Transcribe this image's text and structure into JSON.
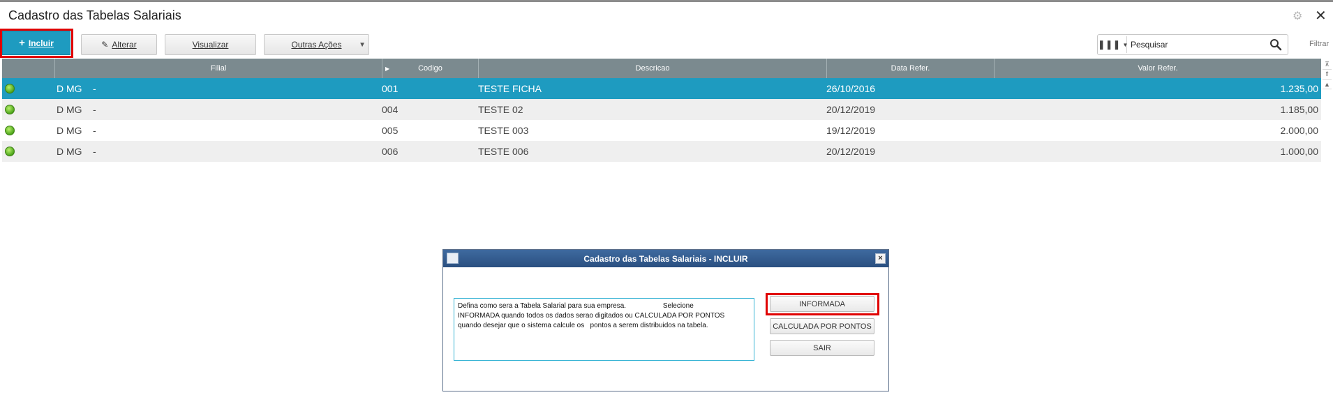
{
  "window": {
    "title": "Cadastro das Tabelas Salariais"
  },
  "toolbar": {
    "incluir": "Incluir",
    "alterar": "Alterar",
    "visualizar": "Visualizar",
    "outras_acoes": "Outras Ações"
  },
  "search": {
    "value": "Pesquisar",
    "filter_label": "Filtrar"
  },
  "table": {
    "columns": [
      "Filial",
      "Codigo",
      "Descricao",
      "Data Refer.",
      "Valor Refer."
    ],
    "rows": [
      {
        "filial": "D MG",
        "sep": "-",
        "codigo": "001",
        "descricao": "TESTE FICHA",
        "data": "26/10/2016",
        "valor": "1.235,00"
      },
      {
        "filial": "D MG",
        "sep": "-",
        "codigo": "004",
        "descricao": "TESTE 02",
        "data": "20/12/2019",
        "valor": "1.185,00"
      },
      {
        "filial": "D MG",
        "sep": "-",
        "codigo": "005",
        "descricao": "TESTE 003",
        "data": "19/12/2019",
        "valor": "2.000,00"
      },
      {
        "filial": "D MG",
        "sep": "-",
        "codigo": "006",
        "descricao": "TESTE 006",
        "data": "20/12/2019",
        "valor": "1.000,00"
      }
    ]
  },
  "dialog": {
    "title": "Cadastro das Tabelas Salariais - INCLUIR",
    "message": "Defina como sera a Tabela Salarial para sua empresa.                   Selecione\nINFORMADA quando todos os dados serao digitados ou CALCULADA POR PONTOS\nquando desejar que o sistema calcule os   pontos a serem distribuidos na tabela.",
    "buttons": [
      "INFORMADA",
      "CALCULADA POR PONTOS",
      "SAIR"
    ]
  },
  "colors": {
    "accent": "#1e9bc0",
    "header": "#7b8a8f",
    "highlight": "#e00000",
    "status": "#4da51b"
  }
}
